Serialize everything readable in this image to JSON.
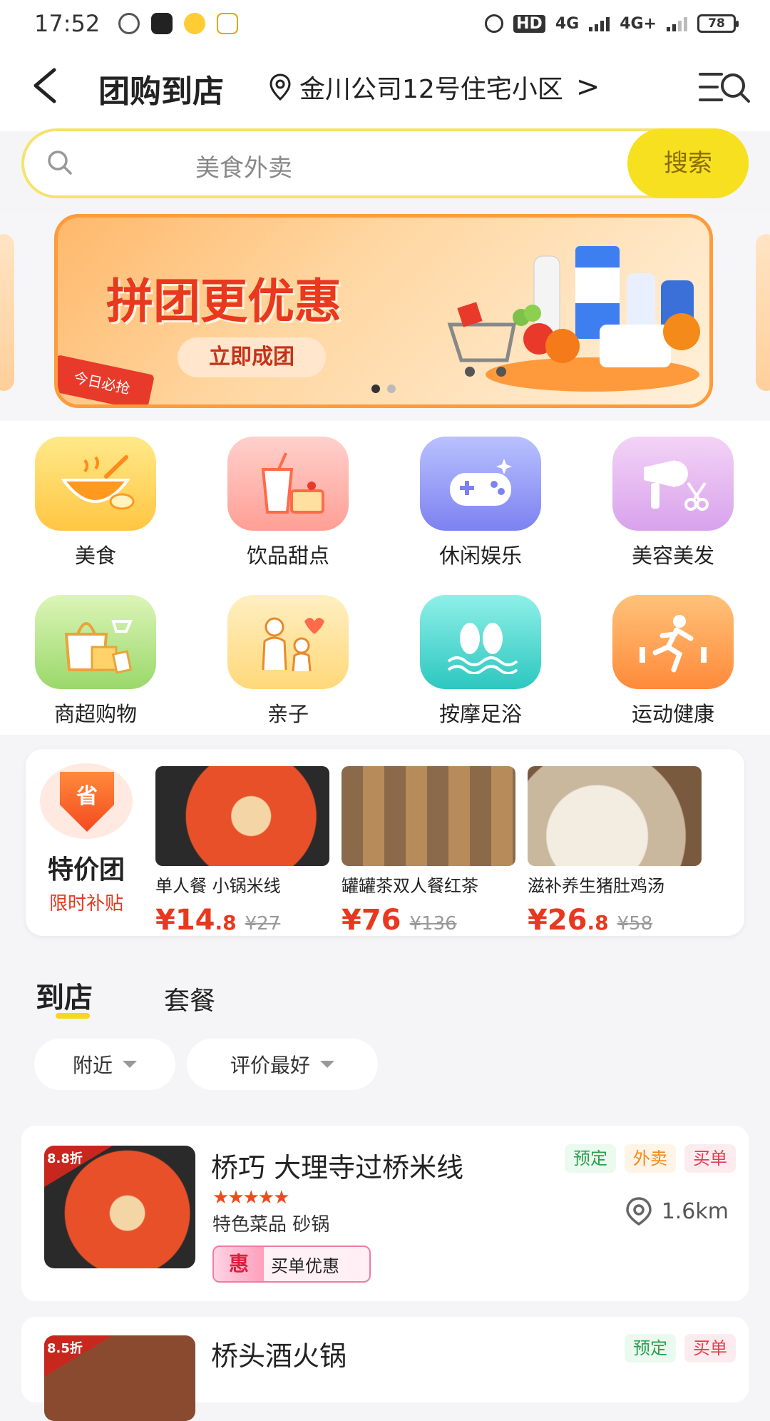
{
  "status_bar": {
    "time": "17:52",
    "network1": "HD",
    "network2": "4G",
    "network3": "4G+",
    "battery": "78"
  },
  "header": {
    "title": "团购到店",
    "location": "金川公司12号住宅小区",
    "location_arrow": ">",
    "back": "<"
  },
  "search": {
    "placeholder": "美食外卖",
    "button": "搜索"
  },
  "banner": {
    "title": "拼团更优惠",
    "button": "立即成团",
    "tag": "今日必抢"
  },
  "categories": [
    {
      "label": "美食",
      "icon": "food-bowl-icon"
    },
    {
      "label": "饮品甜点",
      "icon": "drink-dessert-icon"
    },
    {
      "label": "休闲娱乐",
      "icon": "gamepad-icon"
    },
    {
      "label": "美容美发",
      "icon": "hairdryer-scissors-icon"
    },
    {
      "label": "商超购物",
      "icon": "shopping-bag-icon"
    },
    {
      "label": "亲子",
      "icon": "parent-child-icon"
    },
    {
      "label": "按摩足浴",
      "icon": "footprints-icon"
    },
    {
      "label": "运动健康",
      "icon": "runner-icon"
    }
  ],
  "deals": {
    "badge": "省",
    "title": "特价团",
    "subtitle": "限时补贴",
    "items": [
      {
        "name": "单人餐  小锅米线",
        "price_int": "¥14",
        "price_dec": ".8",
        "orig": "¥27"
      },
      {
        "name": "罐罐茶双人餐红茶",
        "price_int": "¥76",
        "price_dec": "",
        "orig": "¥136"
      },
      {
        "name": "滋补养生猪肚鸡汤",
        "price_int": "¥26",
        "price_dec": ".8",
        "orig": "¥58"
      }
    ]
  },
  "tabs": [
    {
      "label": "到店"
    },
    {
      "label": "套餐"
    }
  ],
  "filters": [
    {
      "label": "附近"
    },
    {
      "label": "评价最好"
    }
  ],
  "shops": [
    {
      "name": "桥巧 大理寺过桥米线",
      "stars": "★★★★★",
      "sub": "特色菜品 砂锅",
      "discount": "8.8折",
      "badges": [
        "预定",
        "外卖",
        "买单"
      ],
      "distance": "1.6km",
      "coupon_icon": "惠",
      "coupon": "买单优惠"
    },
    {
      "name": "桥头酒火锅",
      "discount": "8.5折",
      "badges": [
        "预定",
        "买单"
      ]
    }
  ],
  "colors": {
    "accent": "#f7e020",
    "price": "#e8381e"
  }
}
